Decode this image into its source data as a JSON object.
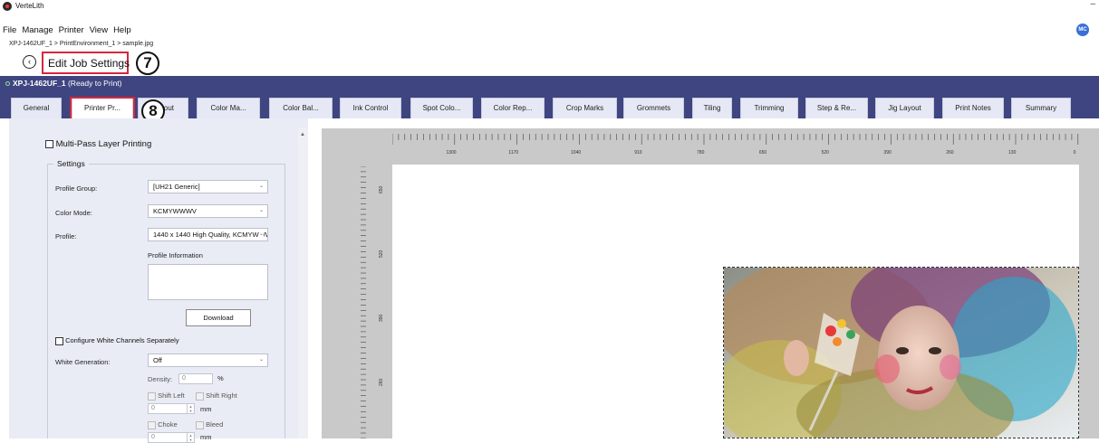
{
  "app": {
    "name": "VerteLith",
    "minimize": "–"
  },
  "menu": [
    "File",
    "Manage",
    "Printer",
    "View",
    "Help"
  ],
  "user": {
    "initials": "MC"
  },
  "breadcrumb": "XPJ-1462UF_1 > PrintEnvironment_1 > sample.jpg",
  "page_title": "Edit Job Settings",
  "annotations": {
    "badge7": "7",
    "badge8": "8"
  },
  "printer": {
    "name": "XPJ-1462UF_1",
    "status": "(Ready to Print)"
  },
  "tabs": [
    "General",
    "Printer Pr...",
    "Layout",
    "Color Ma...",
    "Color Bal...",
    "Ink Control",
    "Spot Colo...",
    "Color Rep...",
    "Crop Marks",
    "Grommets",
    "Tiling",
    "Trimming",
    "Step & Re...",
    "Jig Layout",
    "Print Notes",
    "Summary"
  ],
  "active_tab": "Printer Pr...",
  "settings": {
    "multipass_label": "Multi-Pass Layer Printing",
    "group_label": "Settings",
    "profile_group_label": "Profile Group:",
    "profile_group_value": "[UH21 Generic]",
    "color_mode_label": "Color Mode:",
    "color_mode_value": "KCMYWWWV",
    "profile_label": "Profile:",
    "profile_value": "1440 x 1440 High Quality, KCMYWWWV",
    "profile_info_label": "Profile Information",
    "download_button": "Download",
    "configure_white_label": "Configure White Channels Separately",
    "white_gen_label": "White Generation:",
    "white_gen_value": "Off",
    "density_label": "Density:",
    "density_value": "0",
    "density_unit": "%",
    "shift_left": "Shift Left",
    "shift_right": "Shift Right",
    "shift_value": "0",
    "shift_unit": "mm",
    "choke": "Choke",
    "bleed": "Bleed",
    "choke_value": "0",
    "choke_unit": "mm"
  },
  "ruler": {
    "horizontal": [
      "1300",
      "1170",
      "1040",
      "910",
      "780",
      "650",
      "520",
      "390",
      "260",
      "130",
      "0"
    ],
    "vertical": [
      "650",
      "520",
      "390",
      "260"
    ]
  },
  "colors": {
    "accent": "#3f4580",
    "highlight": "#d6283b",
    "panel": "#e9ecf4"
  }
}
